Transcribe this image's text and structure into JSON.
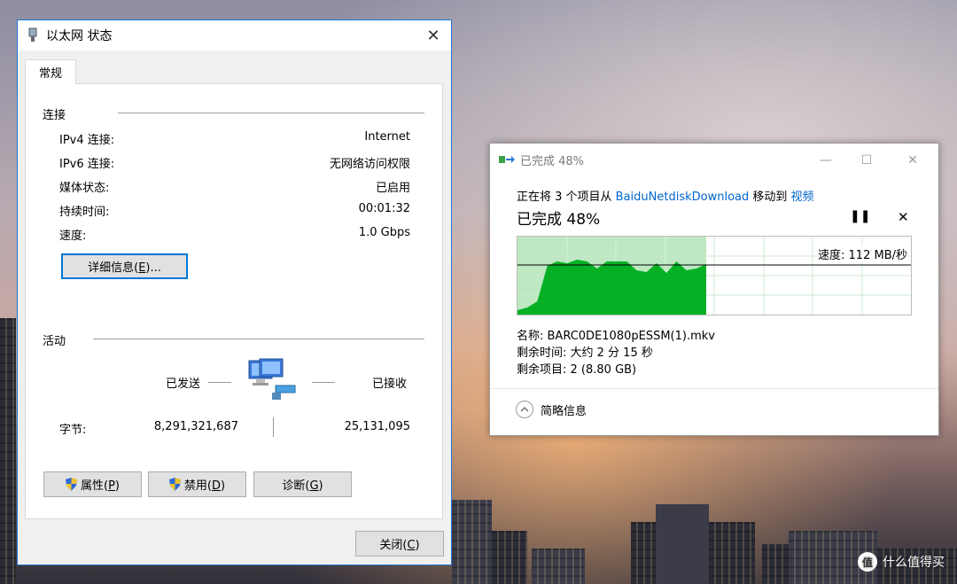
{
  "ethernet_window": {
    "title": "以太网 状态",
    "tab_general": "常规",
    "connection": {
      "title": "连接",
      "rows": [
        {
          "label": "IPv4 连接:",
          "value": "Internet"
        },
        {
          "label": "IPv6 连接:",
          "value": "无网络访问权限"
        },
        {
          "label": "媒体状态:",
          "value": "已启用"
        },
        {
          "label": "持续时间:",
          "value": "00:01:32"
        },
        {
          "label": "速度:",
          "value": "1.0 Gbps"
        }
      ],
      "details_button": {
        "text": "详细信息(",
        "key": "E",
        "suffix": ")..."
      }
    },
    "activity": {
      "title": "活动",
      "sent_label": "已发送",
      "received_label": "已接收",
      "bytes_label": "字节:",
      "bytes_sent": "8,291,321,687",
      "bytes_received": "25,131,095"
    },
    "buttons": {
      "properties": {
        "text": "属性(",
        "key": "P",
        "suffix": ")"
      },
      "disable": {
        "text": "禁用(",
        "key": "D",
        "suffix": ")"
      },
      "diagnose": {
        "text": "诊断(",
        "key": "G",
        "suffix": ")"
      },
      "close": {
        "text": "关闭(",
        "key": "C",
        "suffix": ")"
      }
    }
  },
  "copy_window": {
    "title": "已完成 48%",
    "description_prefix": "正在将 3 个项目从 ",
    "source": "BaiduNetdiskDownload",
    "description_mid": " 移动到 ",
    "destination": "视频",
    "progress_label": "已完成 48%",
    "progress": 0.48,
    "speed_text": "速度: 112 MB/秒",
    "name_line": "名称: BARC0DE1080pESSM(1).mkv",
    "time_line": "剩余时间: 大约 2 分 15 秒",
    "items_line": "剩余项目: 2 (8.80 GB)",
    "less_details": "简略信息",
    "speed_samples": [
      5,
      8,
      15,
      55,
      60,
      58,
      62,
      60,
      52,
      60,
      60,
      60,
      50,
      48,
      58,
      47,
      60,
      50,
      52,
      57
    ]
  },
  "watermark": {
    "badge": "值",
    "text": "什么值得买"
  },
  "colors": {
    "accent": "#0078d7",
    "progress_fill": "#06b025",
    "progress_bg": "#bde8c2"
  }
}
